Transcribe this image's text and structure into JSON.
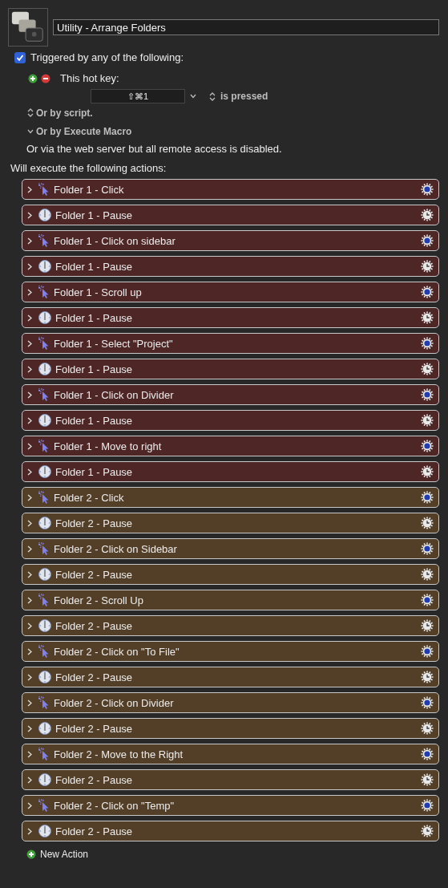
{
  "macro": {
    "name": "Utility - Arrange Folders"
  },
  "trigger": {
    "label": "Triggered by any of the following:",
    "checked": true
  },
  "hotkey": {
    "label": "This hot key:",
    "keys": "⇧⌘1",
    "condition": "is pressed"
  },
  "options": [
    {
      "label": "Or by script.",
      "kind": "updown"
    },
    {
      "label": "Or by Execute Macro",
      "kind": "down"
    }
  ],
  "web_note": "Or via the web server but all remote access is disabled.",
  "actions_heading": "Will execute the following actions:",
  "actions": [
    {
      "label": "Folder 1 - Click",
      "kind": "click",
      "color": "#4e2626"
    },
    {
      "label": "Folder 1 - Pause",
      "kind": "pause",
      "color": "#4e2626"
    },
    {
      "label": "Folder 1 - Click on sidebar",
      "kind": "click",
      "color": "#4e2626"
    },
    {
      "label": "Folder 1 - Pause",
      "kind": "pause",
      "color": "#4e2626"
    },
    {
      "label": "Folder 1 - Scroll up",
      "kind": "click",
      "color": "#4e2626"
    },
    {
      "label": "Folder 1 - Pause",
      "kind": "pause",
      "color": "#4e2626"
    },
    {
      "label": "Folder 1 - Select \"Project\"",
      "kind": "click",
      "color": "#4e2626"
    },
    {
      "label": "Folder 1 - Pause",
      "kind": "pause",
      "color": "#4e2626"
    },
    {
      "label": "Folder 1 - Click on Divider",
      "kind": "click",
      "color": "#4e2626"
    },
    {
      "label": "Folder 1 - Pause",
      "kind": "pause",
      "color": "#4e2626"
    },
    {
      "label": "Folder 1 - Move to right",
      "kind": "click",
      "color": "#4e2626"
    },
    {
      "label": "Folder 1 - Pause",
      "kind": "pause",
      "color": "#4e2626"
    },
    {
      "label": "Folder 2 - Click",
      "kind": "click",
      "color": "#533f28"
    },
    {
      "label": "Folder 2 - Pause",
      "kind": "pause",
      "color": "#533f28"
    },
    {
      "label": "Folder 2 - Click on Sidebar",
      "kind": "click",
      "color": "#533f28"
    },
    {
      "label": "Folder 2 - Pause",
      "kind": "pause",
      "color": "#533f28"
    },
    {
      "label": "Folder 2 - Scroll Up",
      "kind": "click",
      "color": "#533f28"
    },
    {
      "label": "Folder 2 - Pause",
      "kind": "pause",
      "color": "#533f28"
    },
    {
      "label": "Folder 2 - Click on \"To File\"",
      "kind": "click",
      "color": "#533f28"
    },
    {
      "label": "Folder 2 - Pause",
      "kind": "pause",
      "color": "#533f28"
    },
    {
      "label": "Folder 2 - Click on Divider",
      "kind": "click",
      "color": "#533f28"
    },
    {
      "label": "Folder 2 - Pause",
      "kind": "pause",
      "color": "#533f28"
    },
    {
      "label": "Folder 2 - Move to the Right",
      "kind": "click",
      "color": "#533f28"
    },
    {
      "label": "Folder 2 - Pause",
      "kind": "pause",
      "color": "#533f28"
    },
    {
      "label": "Folder 2 - Click on \"Temp\"",
      "kind": "click",
      "color": "#533f28"
    },
    {
      "label": "Folder 2 - Pause",
      "kind": "pause",
      "color": "#533f28"
    }
  ],
  "new_action": "New Action"
}
